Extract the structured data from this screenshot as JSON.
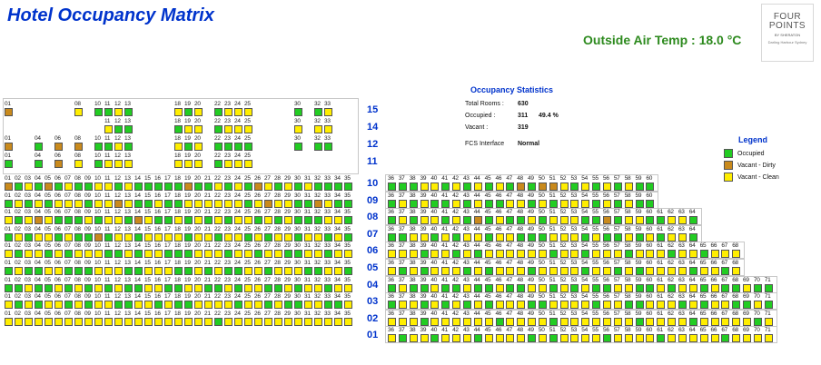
{
  "title": "Hotel Occupancy Matrix",
  "temperature": "Outside Air Temp : 18.0 °C",
  "logo": {
    "line1": "FOUR",
    "line2": "POINTS",
    "line3": "BY SHERATON",
    "line4": "Darling Harbour Sydney"
  },
  "colors": {
    "occupied": "#22cc22",
    "dirty": "#c98a1c",
    "clean": "#ffee00",
    "label": "#0033cc"
  },
  "stats": {
    "title": "Occupancy Statistics",
    "total_label": "Total Rooms :",
    "total_value": "630",
    "occupied_label": "Occupied :",
    "occupied_value": "311",
    "occupied_pct": "49.4 %",
    "vacant_label": "Vacant :",
    "vacant_value": "319",
    "fcs_label": "FCS Interface",
    "fcs_value": "Normal"
  },
  "legend": {
    "title": "Legend",
    "items": [
      {
        "label": "Occupied",
        "status": "occupied"
      },
      {
        "label": "Vacant - Dirty",
        "status": "dirty"
      },
      {
        "label": "Vacant - Clean",
        "status": "clean"
      }
    ]
  },
  "floors": [
    {
      "label": "15",
      "left_rooms": [
        1,
        8,
        10,
        11,
        12,
        13,
        18,
        19,
        20,
        22,
        23,
        24,
        25,
        30,
        32,
        33
      ],
      "left_status": "DOGGOGOGYGOOOGGO",
      "right_rooms": [],
      "right_status": ""
    },
    {
      "label": "14",
      "left_rooms": [
        11,
        12,
        13,
        18,
        19,
        20,
        22,
        23,
        24,
        25,
        30,
        32,
        33
      ],
      "left_status": "OGGGOOGYOYOOO",
      "right_rooms": [],
      "right_status": ""
    },
    {
      "label": "12",
      "left_rooms": [
        1,
        4,
        6,
        8,
        10,
        11,
        12,
        13,
        18,
        19,
        20,
        22,
        23,
        24,
        25,
        30,
        32,
        33
      ],
      "left_status": "DGDDGGYGOGOGGGGGGG",
      "right_rooms": [],
      "right_status": ""
    },
    {
      "label": "11",
      "left_rooms": [
        1,
        4,
        6,
        8,
        10,
        11,
        12,
        13,
        18,
        19,
        20,
        22,
        23,
        24,
        25
      ],
      "left_status": "GGDYGYOYOOOGYYY",
      "right_rooms": [],
      "right_status": ""
    },
    {
      "label": "10",
      "left_rooms": [
        1,
        2,
        3,
        4,
        5,
        6,
        7,
        8,
        9,
        10,
        11,
        12,
        13,
        14,
        15,
        16,
        17,
        18,
        19,
        20,
        21,
        22,
        23,
        24,
        25,
        26,
        27,
        28,
        29,
        30,
        31,
        32,
        33,
        34,
        35
      ],
      "left_status": "DGOGDGOGGOOGOGGGGGDGGOGOGDOGOGOGGGG",
      "right_rooms": [
        36,
        37,
        38,
        39,
        40,
        41,
        42,
        43,
        44,
        45,
        46,
        47,
        48,
        49,
        50,
        51,
        52,
        53,
        54,
        55,
        56,
        57,
        58,
        59,
        60
      ],
      "right_status": "GGGOOGOGYGYGDGDDOGYGOGOGG"
    },
    {
      "label": "09",
      "left_rooms": [
        1,
        2,
        3,
        4,
        5,
        6,
        7,
        8,
        9,
        10,
        11,
        12,
        13,
        14,
        15,
        16,
        17,
        18,
        19,
        20,
        21,
        22,
        23,
        24,
        25,
        26,
        27,
        28,
        29,
        30,
        31,
        32,
        33,
        34,
        35
      ],
      "left_status": "GYGYGOYOGOYDYGGYGGOYOOOYGYDYOGGDYGG",
      "right_rooms": [
        36,
        37,
        38,
        39,
        40,
        41,
        42,
        43,
        44,
        45,
        46,
        47,
        48,
        49,
        50,
        51,
        52,
        53,
        54,
        55,
        56,
        57,
        58,
        59,
        60
      ],
      "right_status": "GOGYGGYGOGGOYGYGOYOGYGOGG"
    },
    {
      "label": "08",
      "left_rooms": [
        1,
        2,
        3,
        4,
        5,
        6,
        7,
        8,
        9,
        10,
        11,
        12,
        13,
        14,
        15,
        16,
        17,
        18,
        19,
        20,
        21,
        22,
        23,
        24,
        25,
        26,
        27,
        28,
        29,
        30,
        31,
        32,
        33,
        34,
        35
      ],
      "left_status": "OGYDOGGGOGOYGDYGGOGYGOGYOGOGYGGGOOG",
      "right_rooms": [
        36,
        37,
        38,
        39,
        40,
        41,
        42,
        43,
        44,
        45,
        46,
        47,
        48,
        49,
        50,
        51,
        52,
        53,
        54,
        55,
        56,
        57,
        58,
        59,
        60,
        61,
        62,
        63,
        64
      ],
      "right_status": "GOGYOGYGDGOGGOGYOOGGDGYYGGOYG"
    },
    {
      "label": "07",
      "left_rooms": [
        1,
        2,
        3,
        4,
        5,
        6,
        7,
        8,
        9,
        10,
        11,
        12,
        13,
        14,
        15,
        16,
        17,
        18,
        19,
        20,
        21,
        22,
        23,
        24,
        25,
        26,
        27,
        28,
        29,
        30,
        31,
        32,
        33,
        34,
        35
      ],
      "left_status": "GYGOOGYGGDGOYGYOYOGYOGYOGOGOYGYOGOG",
      "right_rooms": [
        36,
        37,
        38,
        39,
        40,
        41,
        42,
        43,
        44,
        45,
        46,
        47,
        48,
        49,
        50,
        51,
        52,
        53,
        54,
        55,
        56,
        57,
        58,
        59,
        60,
        61,
        62,
        63,
        64
      ],
      "right_status": "GGOYGOGYOGYOGGGOYOGOGGOGYGOYG"
    },
    {
      "label": "06",
      "left_rooms": [
        1,
        2,
        3,
        4,
        5,
        6,
        7,
        8,
        9,
        10,
        11,
        12,
        13,
        14,
        15,
        16,
        17,
        18,
        19,
        20,
        21,
        22,
        23,
        24,
        25,
        26,
        27,
        28,
        29,
        30,
        31,
        32,
        33,
        34,
        35
      ],
      "left_status": "OGOYGYGOYYGGOGYOGGGYYOGOYGYOGGOYGOO",
      "right_rooms": [
        36,
        37,
        38,
        39,
        40,
        41,
        42,
        43,
        44,
        45,
        46,
        47,
        48,
        49,
        50,
        51,
        52,
        53,
        54,
        55,
        56,
        57,
        58,
        59,
        60,
        61,
        62,
        63,
        64,
        65,
        66,
        67,
        68
      ],
      "right_status": "YYOGYYGYGOYYOOYGYYGYYOGOYYGYOGYYY"
    },
    {
      "label": "05",
      "left_rooms": [
        1,
        2,
        3,
        4,
        5,
        6,
        7,
        8,
        9,
        10,
        11,
        12,
        13,
        14,
        15,
        16,
        17,
        18,
        19,
        20,
        21,
        22,
        23,
        24,
        25,
        26,
        27,
        28,
        29,
        30,
        31,
        32,
        33,
        34,
        35
      ],
      "left_status": "GYGGOYGGGOYOGGOYYGGYGYGGOYGOYOGGYOG",
      "right_rooms": [
        36,
        37,
        38,
        39,
        40,
        41,
        42,
        43,
        44,
        45,
        46,
        47,
        48,
        49,
        50,
        51,
        52,
        53,
        54,
        55,
        56,
        57,
        58,
        59,
        60,
        61,
        62,
        63,
        64,
        65,
        66,
        67,
        68
      ],
      "right_status": "YGYGOYOGYGOYOGOOYOGYOGYGOOYOGYOGO"
    },
    {
      "label": "04",
      "left_rooms": [
        1,
        2,
        3,
        4,
        5,
        6,
        7,
        8,
        9,
        10,
        11,
        12,
        13,
        14,
        15,
        16,
        17,
        18,
        19,
        20,
        21,
        22,
        23,
        24,
        25,
        26,
        27,
        28,
        29,
        30,
        31,
        32,
        33,
        34,
        35
      ],
      "left_status": "GGOGGOGOGOGOGGOYGGOOGGOGOOGGOGOOGOO",
      "right_rooms": [
        36,
        37,
        38,
        39,
        40,
        41,
        42,
        43,
        44,
        45,
        46,
        47,
        48,
        49,
        50,
        51,
        52,
        53,
        54,
        55,
        56,
        57,
        58,
        59,
        60,
        61,
        62,
        63,
        64,
        65,
        66,
        67,
        68,
        69,
        70,
        71
      ],
      "right_status": "GOGGOGGOGGOGGOOGOGOGGOOGGOGOOGYGGOGG"
    },
    {
      "label": "03",
      "left_rooms": [
        1,
        2,
        3,
        4,
        5,
        6,
        7,
        8,
        9,
        10,
        11,
        12,
        13,
        14,
        15,
        16,
        17,
        18,
        19,
        20,
        21,
        22,
        23,
        24,
        25,
        26,
        27,
        28,
        29,
        30,
        31,
        32,
        33,
        34,
        35
      ],
      "left_status": "YGOGYOGYGOOGGOYGOGGYOOOGYOGOGGYOGGO",
      "right_rooms": [
        36,
        37,
        38,
        39,
        40,
        41,
        42,
        43,
        44,
        45,
        46,
        47,
        48,
        49,
        50,
        51,
        52,
        53,
        54,
        55,
        56,
        57,
        58,
        59,
        60,
        61,
        62,
        63,
        64,
        65,
        66,
        67,
        68,
        69,
        70,
        71
      ],
      "right_status": "GYOGOGYGOGOOYGGOYOOGYOGGOYOGOGYOGGOG"
    },
    {
      "label": "02",
      "left_rooms": [
        1,
        2,
        3,
        4,
        5,
        6,
        7,
        8,
        9,
        10,
        11,
        12,
        13,
        14,
        15,
        16,
        17,
        18,
        19,
        20,
        21,
        22,
        23,
        24,
        25,
        26,
        27,
        28,
        29,
        30,
        31,
        32,
        33,
        34,
        35
      ],
      "left_status": "YYYOYYYOYYYYOYYYYYYYYGYYYYYYYYYYYYY",
      "right_rooms": [
        36,
        37,
        38,
        39,
        40,
        41,
        42,
        43,
        44,
        45,
        46,
        47,
        48,
        49,
        50,
        51,
        52,
        53,
        54,
        55,
        56,
        57,
        58,
        59,
        60,
        61,
        62,
        63,
        64,
        65,
        66,
        67,
        68,
        69,
        70,
        71
      ],
      "right_status": "YYOGYYYOYYGYYOYGYYOYYOYGOYYYGYOYYYGY"
    },
    {
      "label": "01",
      "left_rooms": [],
      "left_status": "",
      "right_rooms": [
        36,
        37,
        38,
        39,
        40,
        41,
        42,
        43,
        44,
        45,
        46,
        47,
        48,
        49,
        50,
        51,
        52,
        53,
        54,
        55,
        56,
        57,
        58,
        59,
        60,
        61,
        62,
        63,
        64,
        65,
        66,
        67,
        68,
        69,
        70,
        71
      ],
      "right_status": "YGYYGYYYGYYYYGYGYYYYGYYYYGYYYYYGYYYY"
    }
  ]
}
